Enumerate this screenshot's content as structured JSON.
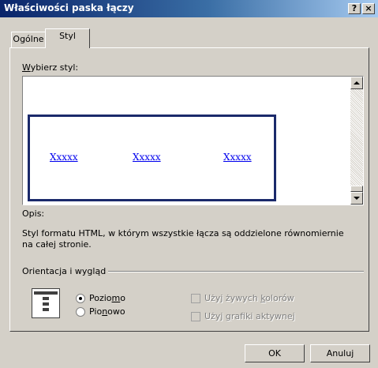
{
  "window": {
    "title": "Właściwości paska łączy",
    "help_label": "?",
    "close_label": "×"
  },
  "tabs": [
    {
      "label": "Ogólne",
      "selected": false
    },
    {
      "label": "Styl",
      "selected": true
    }
  ],
  "style_list": {
    "label_prefix": "W",
    "label_rest": "ybierz styl:",
    "preview_links": [
      "Xxxxx",
      "Xxxxx",
      "Xxxxx"
    ]
  },
  "description": {
    "label": "Opis:",
    "text": "Styl formatu HTML, w którym wszystkie łącza są oddzielone równomiernie na całej stronie."
  },
  "orientation": {
    "group_label": "Orientacja i wygląd",
    "horizontal": {
      "before": "Pozio",
      "accel": "m",
      "after": "o",
      "selected": true
    },
    "vertical": {
      "before": "Pio",
      "accel": "n",
      "after": "owo",
      "selected": false
    }
  },
  "options": {
    "vivid_colors": {
      "before": "Użyj żywych ",
      "accel": "k",
      "after": "olorów",
      "checked": false,
      "enabled": false
    },
    "active_graphics": {
      "before": "Użyj ",
      "accel": "g",
      "after": "rafiki aktywnej",
      "checked": false,
      "enabled": false
    }
  },
  "buttons": {
    "ok": "OK",
    "cancel": "Anuluj"
  },
  "colors": {
    "title_start": "#0a246a",
    "title_end": "#a6caf0",
    "face": "#d4d0c8",
    "link": "#0000ee",
    "preview_border": "#1b2a6b"
  }
}
